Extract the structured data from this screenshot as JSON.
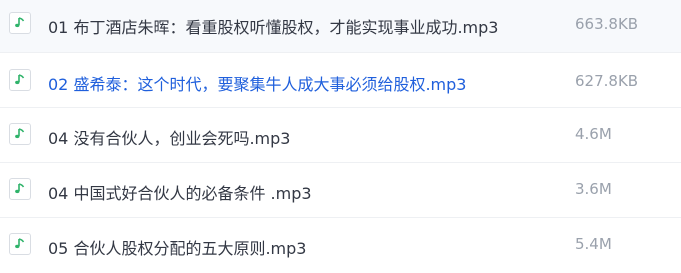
{
  "file_list": {
    "rows": [
      {
        "icon": "music-file-icon",
        "name": "01 布丁酒店朱晖：看重股权听懂股权，才能实现事业成功.mp3",
        "size": "663.8KB",
        "selected": false
      },
      {
        "icon": "music-file-icon",
        "name": "02 盛希泰：这个时代，要聚集牛人成大事必须给股权.mp3",
        "size": "627.8KB",
        "selected": true
      },
      {
        "icon": "music-file-icon",
        "name": "04 没有合伙人，创业会死吗.mp3",
        "size": "4.6M",
        "selected": false
      },
      {
        "icon": "music-file-icon",
        "name": "04 中国式好合伙人的必备条件 .mp3",
        "size": "3.6M",
        "selected": false
      },
      {
        "icon": "music-file-icon",
        "name": "05 合伙人股权分配的五大原则.mp3",
        "size": "5.4M",
        "selected": false
      }
    ],
    "colors": {
      "icon_accent": "#2fb36a",
      "selected_text": "#1f5fdc",
      "text": "#333844",
      "size_text": "#9aa1ac"
    }
  }
}
